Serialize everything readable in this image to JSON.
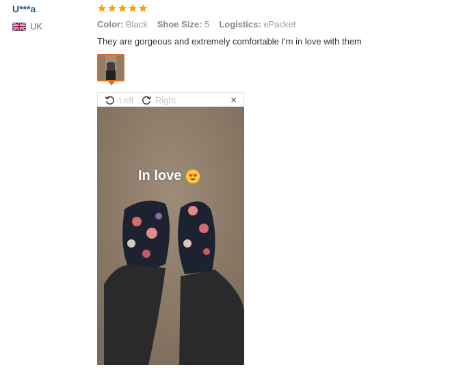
{
  "reviewer": {
    "name": "U***a",
    "country": "UK",
    "flag_icon": "uk-flag-icon"
  },
  "rating": {
    "stars": 5,
    "max": 5,
    "color": "#f7a30c"
  },
  "attributes": [
    {
      "key": "Color:",
      "value": "Black"
    },
    {
      "key": "Shoe Size:",
      "value": "5"
    },
    {
      "key": "Logistics:",
      "value": "ePacket"
    }
  ],
  "review_text": "They are gorgeous and extremely comfortable I'm in love with them",
  "viewer": {
    "rotate_left_label": "Left",
    "rotate_right_label": "Right",
    "close_label": "×"
  },
  "photo": {
    "caption": "In love",
    "emoji": "heart-eyes-emoji"
  },
  "colors": {
    "accent": "#e96b17",
    "link": "#1f5a99"
  }
}
